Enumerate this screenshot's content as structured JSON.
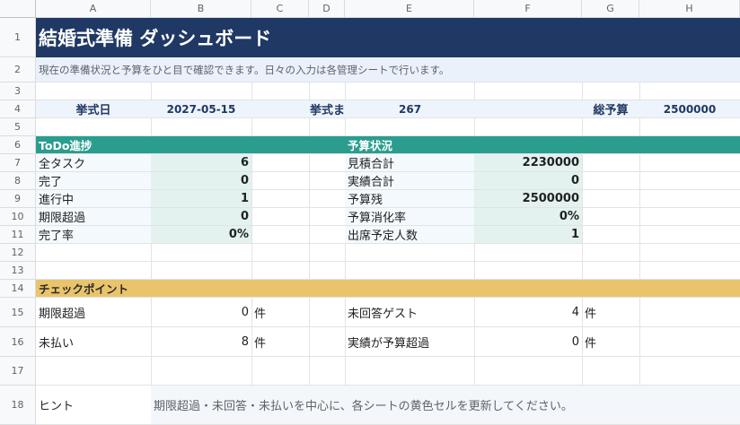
{
  "columns": [
    "A",
    "B",
    "C",
    "D",
    "E",
    "F",
    "G",
    "H"
  ],
  "rows": [
    "1",
    "2",
    "3",
    "4",
    "5",
    "6",
    "7",
    "8",
    "9",
    "10",
    "11",
    "12",
    "13",
    "14",
    "15",
    "16",
    "17",
    "18"
  ],
  "dashboard": {
    "title": "結婚式準備 ダッシュボード",
    "subtitle": "現在の準備状況と予算をひと目で確認できます。日々の入力は各管理シートで行います。",
    "wedding_date_label": "挙式日",
    "wedding_date_value": "2027-05-15",
    "days_left_label": "挙式ま",
    "days_left_value": "267",
    "total_budget_label": "総予算",
    "total_budget_value": "2500000"
  },
  "todo": {
    "header": "ToDo進捗",
    "rows": [
      {
        "label": "全タスク",
        "value": "6"
      },
      {
        "label": "完了",
        "value": "0"
      },
      {
        "label": "進行中",
        "value": "1"
      },
      {
        "label": "期限超過",
        "value": "0"
      },
      {
        "label": "完了率",
        "value": "0%"
      }
    ]
  },
  "budget": {
    "header": "予算状況",
    "rows": [
      {
        "label": "見積合計",
        "value": "2230000"
      },
      {
        "label": "実績合計",
        "value": "0"
      },
      {
        "label": "予算残",
        "value": "2500000"
      },
      {
        "label": "予算消化率",
        "value": "0%"
      },
      {
        "label": "出席予定人数",
        "value": "1"
      }
    ]
  },
  "checkpoints": {
    "header": "チェックポイント",
    "overdue_label": "期限超過",
    "overdue_value": "0",
    "overdue_unit": "件",
    "unpaid_label": "未払い",
    "unpaid_value": "8",
    "unpaid_unit": "件",
    "no_reply_label": "未回答ゲスト",
    "no_reply_value": "4",
    "no_reply_unit": "件",
    "over_budget_label": "実績が予算超過",
    "over_budget_value": "0",
    "over_budget_unit": "件",
    "hint_label": "ヒント",
    "hint_text": "期限超過・未回答・未払いを中心に、各シートの黄色セルを更新してください。"
  },
  "colors": {
    "title_bg": "#203864",
    "subtitle_bg": "#eaf1fb",
    "info_bg": "#eef4fb",
    "section_teal": "#2a9d8f",
    "value_mint": "#e3f2ee",
    "label_bg": "#f4f9fd",
    "checkpoint_gold": "#e9c46a",
    "hint_bg": "#f3f7fb"
  }
}
